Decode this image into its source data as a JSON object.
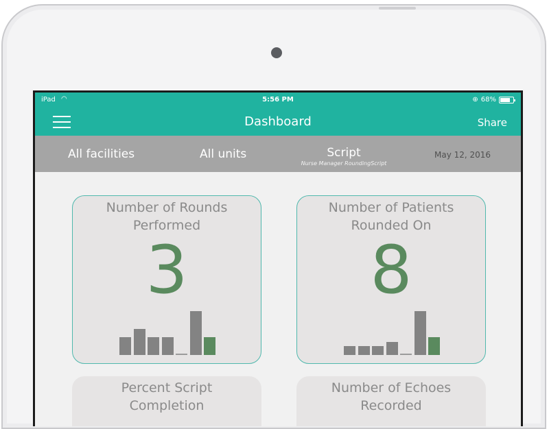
{
  "status": {
    "carrier": "iPad",
    "time": "5:56 PM",
    "battery": "68%"
  },
  "header": {
    "title": "Dashboard",
    "share_label": "Share"
  },
  "filters": {
    "facilities": "All facilities",
    "units": "All units",
    "script": "Script",
    "script_sub": "Nurse Manager RoundingScript",
    "date": "May 12, 2016"
  },
  "cards": [
    {
      "label_line1": "Number of Rounds",
      "label_line2": "Performed",
      "value": "3",
      "bars": [
        2,
        3,
        2,
        2,
        0,
        5,
        2
      ]
    },
    {
      "label_line1": "Number of Patients",
      "label_line2": "Rounded On",
      "value": "8",
      "bars": [
        1,
        1,
        1,
        1.5,
        0,
        5,
        2
      ]
    },
    {
      "label_line1": "Percent Script",
      "label_line2": "Completion"
    },
    {
      "label_line1": "Number of Echoes",
      "label_line2": "Recorded"
    }
  ],
  "colors": {
    "header_teal": "#20b3a0",
    "filter_gray": "#a5a5a5",
    "value_green": "#5a8a5e",
    "card_bg": "#e6e4e4"
  }
}
